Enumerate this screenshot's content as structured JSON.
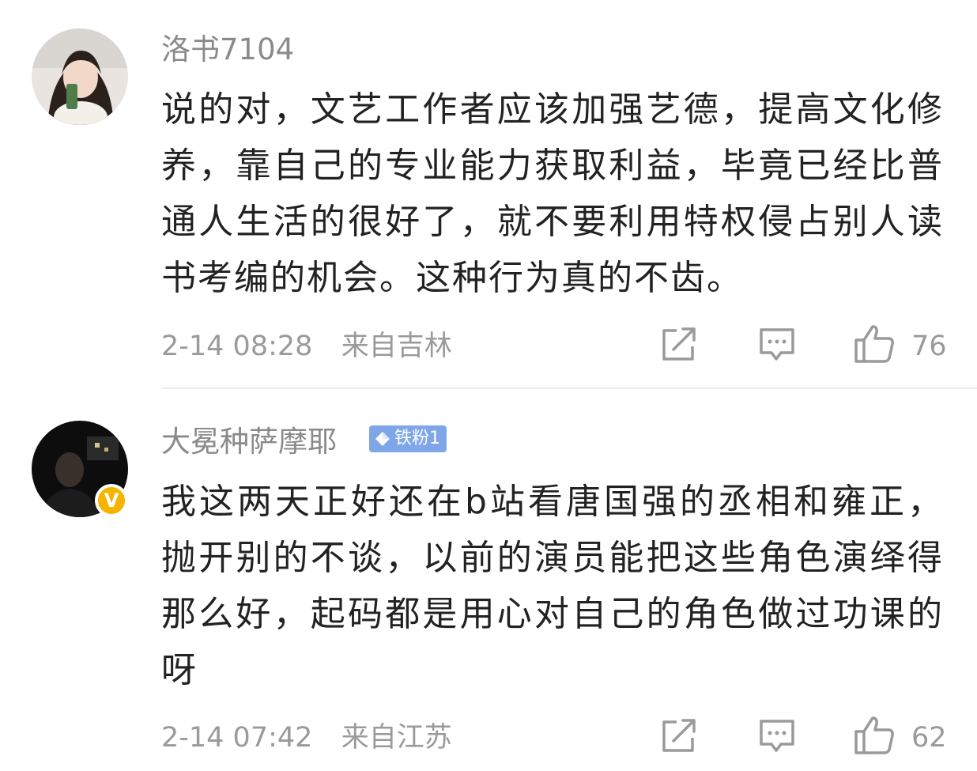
{
  "comments": [
    {
      "username": "洛书7104",
      "text": "说的对，文艺工作者应该加强艺德，提高文化修养，靠自己的专业能力获取利益，毕竟已经比普通人生活的很好了，就不要利用特权侵占别人读书考编的机会。这种行为真的不齿。",
      "time": "2-14 08:28",
      "location": "来自吉林",
      "likes": "76",
      "verified": false
    },
    {
      "username": "大冕种萨摩耶",
      "fan_badge": "铁粉1",
      "text": "我这两天正好还在b站看唐国强的丞相和雍正，抛开别的不谈，以前的演员能把这些角色演绎得那么好，起码都是用心对自己的角色做过功课的呀",
      "time": "2-14 07:42",
      "location": "来自江苏",
      "likes": "62",
      "verified": true,
      "verified_mark": "V"
    }
  ],
  "icons": {
    "share": "share-icon",
    "reply": "comment-icon",
    "like": "thumbs-up-icon"
  },
  "colors": {
    "badge_blue": "#7ea6e8",
    "verified_gold": "#f4b400",
    "meta_gray": "#9a9a9a"
  }
}
